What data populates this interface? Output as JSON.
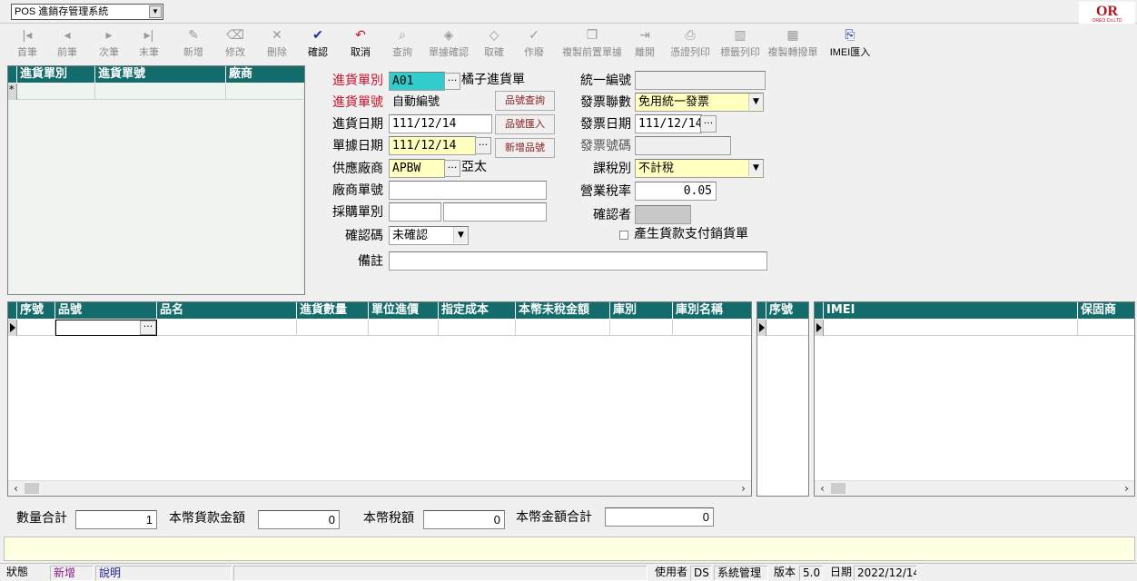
{
  "app": {
    "system_dropdown": "POS 進銷存管理系統",
    "logo_text": "OR",
    "logo_sub": "OREO Co.LTD"
  },
  "toolbar": [
    {
      "id": "first",
      "label": "首筆",
      "icon": "first-icon",
      "enabled": false
    },
    {
      "id": "prev",
      "label": "前筆",
      "icon": "prev-icon",
      "enabled": false
    },
    {
      "id": "next",
      "label": "次筆",
      "icon": "next-icon",
      "enabled": false
    },
    {
      "id": "last",
      "label": "末筆",
      "icon": "last-icon",
      "enabled": false
    },
    {
      "id": "new",
      "label": "新增",
      "icon": "edit-icon",
      "enabled": false
    },
    {
      "id": "modify",
      "label": "修改",
      "icon": "eraser-icon",
      "enabled": false
    },
    {
      "id": "delete",
      "label": "刪除",
      "icon": "close-icon",
      "enabled": false
    },
    {
      "id": "confirm",
      "label": "確認",
      "icon": "check-icon",
      "enabled": true
    },
    {
      "id": "cancel",
      "label": "取消",
      "icon": "undo-icon",
      "enabled": true
    },
    {
      "id": "query",
      "label": "查詢",
      "icon": "search-doc-icon",
      "enabled": false
    },
    {
      "id": "docconfirm",
      "label": "單據確認",
      "icon": "stamp-icon",
      "enabled": false
    },
    {
      "id": "unconfirm",
      "label": "取確",
      "icon": "unstamp-icon",
      "enabled": false
    },
    {
      "id": "void",
      "label": "作廢",
      "icon": "void-icon",
      "enabled": false
    },
    {
      "id": "copyprev",
      "label": "複製前置單據",
      "icon": "copy-icon",
      "enabled": false
    },
    {
      "id": "exit",
      "label": "離開",
      "icon": "exit-icon",
      "enabled": false
    },
    {
      "id": "printvoucher",
      "label": "憑證列印",
      "icon": "printer-icon",
      "enabled": false
    },
    {
      "id": "printlabel",
      "label": "標籤列印",
      "icon": "barcode-icon",
      "enabled": false
    },
    {
      "id": "copytransfer",
      "label": "複製轉撥單",
      "icon": "grid-copy-icon",
      "enabled": false
    },
    {
      "id": "imei",
      "label": "IMEI匯入",
      "icon": "import-icon",
      "enabled": true
    }
  ],
  "list_grid": {
    "columns": [
      "進貨單別",
      "進貨單號",
      "廠商"
    ]
  },
  "form": {
    "doc_type_label": "進貨單別",
    "doc_type_value": "A01",
    "doc_type_name": "橘子進貨單",
    "doc_no_label": "進貨單號",
    "doc_no_value": "自動編號",
    "purchase_date_label": "進貨日期",
    "purchase_date_value": "111/12/14",
    "doc_date_label": "單據日期",
    "doc_date_value": "111/12/14",
    "supplier_label": "供應廠商",
    "supplier_value": "APBW",
    "supplier_name": "亞太",
    "supplier_doc_label": "廠商單號",
    "supplier_doc_value": "",
    "po_type_label": "採購單別",
    "po_type_value": "",
    "po_type_value2": "",
    "confirm_code_label": "確認碼",
    "confirm_code_value": "未確認",
    "memo_label": "備註",
    "memo_value": "",
    "btn_item_query": "品號查詢",
    "btn_item_import": "品號匯入",
    "btn_item_new": "新增品號",
    "tax_id_label": "統一編號",
    "tax_id_value": "",
    "invoice_type_label": "發票聯數",
    "invoice_type_value": "免用統一發票",
    "invoice_date_label": "發票日期",
    "invoice_date_value": "111/12/14",
    "invoice_no_label": "發票號碼",
    "invoice_no_value": "",
    "tax_type_label": "課稅別",
    "tax_type_value": "不計稅",
    "tax_rate_label": "營業稅率",
    "tax_rate_value": "0.05",
    "confirmer_label": "確認者",
    "confirmer_value": "",
    "gen_payment_label": "產生貨款支付銷貨單",
    "gen_payment_checked": false
  },
  "detail_grid": {
    "columns": [
      "序號",
      "品號",
      "品名",
      "進貨數量",
      "單位進價",
      "指定成本",
      "本幣未稅金額",
      "庫別",
      "庫別名稱"
    ]
  },
  "seq_grid": {
    "columns": [
      "序號"
    ]
  },
  "imei_grid": {
    "columns": [
      "IMEI",
      "保固商"
    ]
  },
  "totals": {
    "qty_label": "數量合計",
    "qty_value": "1",
    "amount_label": "本幣貨款金額",
    "amount_value": "0",
    "tax_label": "本幣稅額",
    "tax_value": "0",
    "total_label": "本幣金額合計",
    "total_value": "0"
  },
  "status": {
    "state_label": "狀態",
    "state_value": "新增",
    "help_label": "說明",
    "user_label": "使用者",
    "user_code": "DS",
    "user_name": "系統管理",
    "version_label": "版本",
    "version_value": "5.0",
    "date_label": "日期",
    "date_value": "2022/12/14"
  },
  "colors": {
    "grid_header": "#136b6b",
    "required_label": "#c8102e",
    "highlight_field": "#ffffc0",
    "active_field": "#33cccc"
  }
}
